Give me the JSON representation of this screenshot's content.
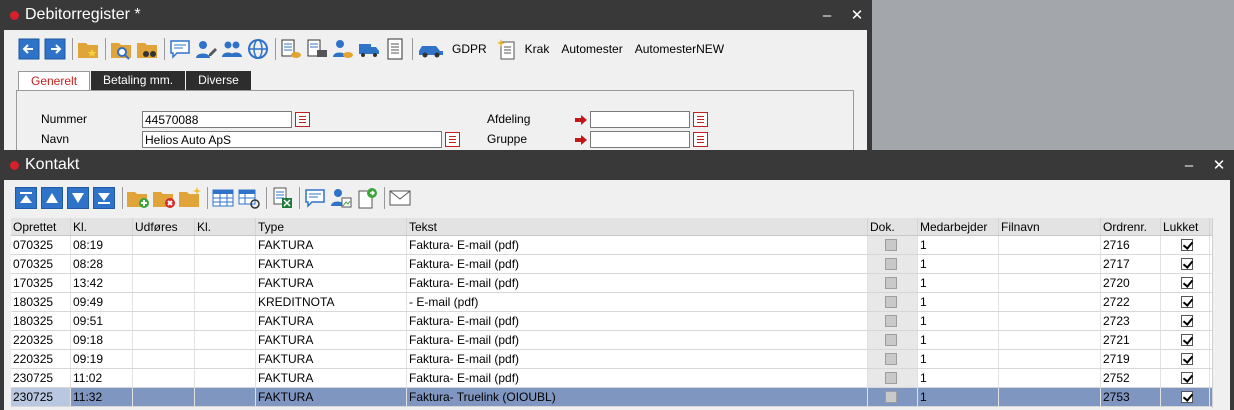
{
  "win1": {
    "title": "Debitorregister *",
    "toolbar_labels": {
      "gdpr": "GDPR",
      "krak": "Krak",
      "automester": "Automester",
      "automesternew": "AutomesterNEW"
    },
    "tabs": [
      {
        "label": "Generelt",
        "active": true
      },
      {
        "label": "Betaling mm.",
        "active": false
      },
      {
        "label": "Diverse",
        "active": false
      }
    ],
    "fields": {
      "nummer_label": "Nummer",
      "nummer_value": "44570088",
      "navn_label": "Navn",
      "navn_value": "Helios Auto ApS",
      "afdeling_label": "Afdeling",
      "afdeling_value": "",
      "gruppe_label": "Gruppe",
      "gruppe_value": ""
    }
  },
  "win2": {
    "title": "Kontakt",
    "columns": [
      "Oprettet",
      "Kl.",
      "Udføres",
      "Kl.",
      "Type",
      "Tekst",
      "Dok.",
      "Medarbejder",
      "Filnavn",
      "Ordrenr.",
      "Lukket"
    ],
    "rows": [
      {
        "oprettet": "070325",
        "kl": "08:19",
        "udfores": "",
        "kl2": "",
        "type": "FAKTURA",
        "tekst": "Faktura- E-mail (pdf)",
        "medarbejder": "1",
        "filnavn": "",
        "ordrenr": "2716",
        "lukket": true
      },
      {
        "oprettet": "070325",
        "kl": "08:28",
        "udfores": "",
        "kl2": "",
        "type": "FAKTURA",
        "tekst": "Faktura- E-mail (pdf)",
        "medarbejder": "1",
        "filnavn": "",
        "ordrenr": "2717",
        "lukket": true
      },
      {
        "oprettet": "170325",
        "kl": "13:42",
        "udfores": "",
        "kl2": "",
        "type": "FAKTURA",
        "tekst": "Faktura- E-mail (pdf)",
        "medarbejder": "1",
        "filnavn": "",
        "ordrenr": "2720",
        "lukket": true
      },
      {
        "oprettet": "180325",
        "kl": "09:49",
        "udfores": "",
        "kl2": "",
        "type": "KREDITNOTA",
        "tekst": "- E-mail (pdf)",
        "medarbejder": "1",
        "filnavn": "",
        "ordrenr": "2722",
        "lukket": true
      },
      {
        "oprettet": "180325",
        "kl": "09:51",
        "udfores": "",
        "kl2": "",
        "type": "FAKTURA",
        "tekst": "Faktura- E-mail (pdf)",
        "medarbejder": "1",
        "filnavn": "",
        "ordrenr": "2723",
        "lukket": true
      },
      {
        "oprettet": "220325",
        "kl": "09:18",
        "udfores": "",
        "kl2": "",
        "type": "FAKTURA",
        "tekst": "Faktura- E-mail (pdf)",
        "medarbejder": "1",
        "filnavn": "",
        "ordrenr": "2721",
        "lukket": true
      },
      {
        "oprettet": "220325",
        "kl": "09:19",
        "udfores": "",
        "kl2": "",
        "type": "FAKTURA",
        "tekst": "Faktura- E-mail (pdf)",
        "medarbejder": "1",
        "filnavn": "",
        "ordrenr": "2719",
        "lukket": true
      },
      {
        "oprettet": "230725",
        "kl": "11:02",
        "udfores": "",
        "kl2": "",
        "type": "FAKTURA",
        "tekst": "Faktura- E-mail (pdf)",
        "medarbejder": "1",
        "filnavn": "",
        "ordrenr": "2752",
        "lukket": true
      },
      {
        "oprettet": "230725",
        "kl": "11:32",
        "udfores": "",
        "kl2": "",
        "type": "FAKTURA",
        "tekst": "Faktura- Truelink (OIOUBL)",
        "medarbejder": "1",
        "filnavn": "",
        "ordrenr": "2753",
        "lukket": true,
        "selected": true
      }
    ]
  },
  "colors": {
    "title_bg": "#393939",
    "accent_red": "#d6202c",
    "nav_blue": "#2f73c8",
    "selected_row": "#7f96c0"
  }
}
